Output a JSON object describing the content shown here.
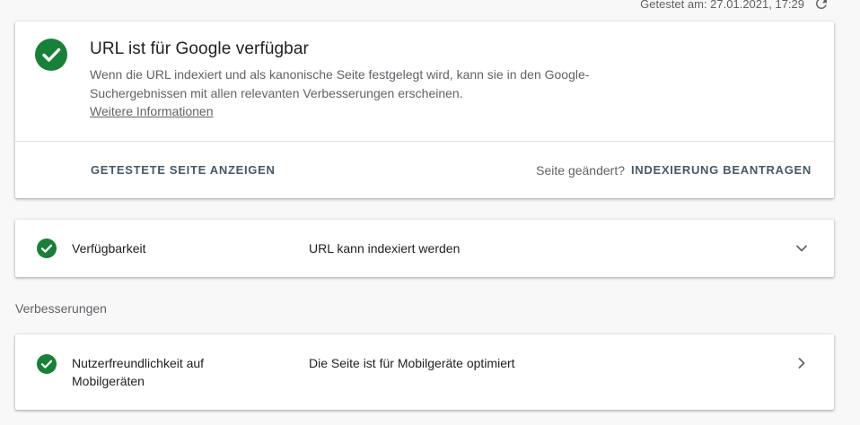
{
  "header": {
    "tested_text": "Getestet am: 27.01.2021, 17:29"
  },
  "status_card": {
    "title": "URL ist für Google verfügbar",
    "description": "Wenn die URL indexiert und als kanonische Seite festgelegt wird, kann sie in den Google-Suchergebnissen mit allen relevanten Verbesserungen erscheinen.",
    "more_info_link": "Weitere Informationen",
    "view_tested_page_button": "GETESTETE SEITE ANZEIGEN",
    "page_changed_text": "Seite geändert?",
    "request_indexing_button": "INDEXIERUNG BEANTRAGEN"
  },
  "availability": {
    "label": "Verfügbarkeit",
    "value": "URL kann indexiert werden"
  },
  "enhancements": {
    "section_label": "Verbesserungen",
    "items": [
      {
        "label": "Nutzerfreundlichkeit auf Mobilgeräten",
        "value": "Die Seite ist für Mobilgeräte optimiert"
      }
    ]
  },
  "colors": {
    "success_green": "#188038",
    "action_text": "#455a64",
    "secondary_text": "#5f6368",
    "primary_text": "#202124"
  },
  "icons": {
    "status": "check-circle-icon",
    "refresh": "refresh-icon",
    "expand": "chevron-down-icon",
    "navigate": "chevron-right-icon"
  }
}
